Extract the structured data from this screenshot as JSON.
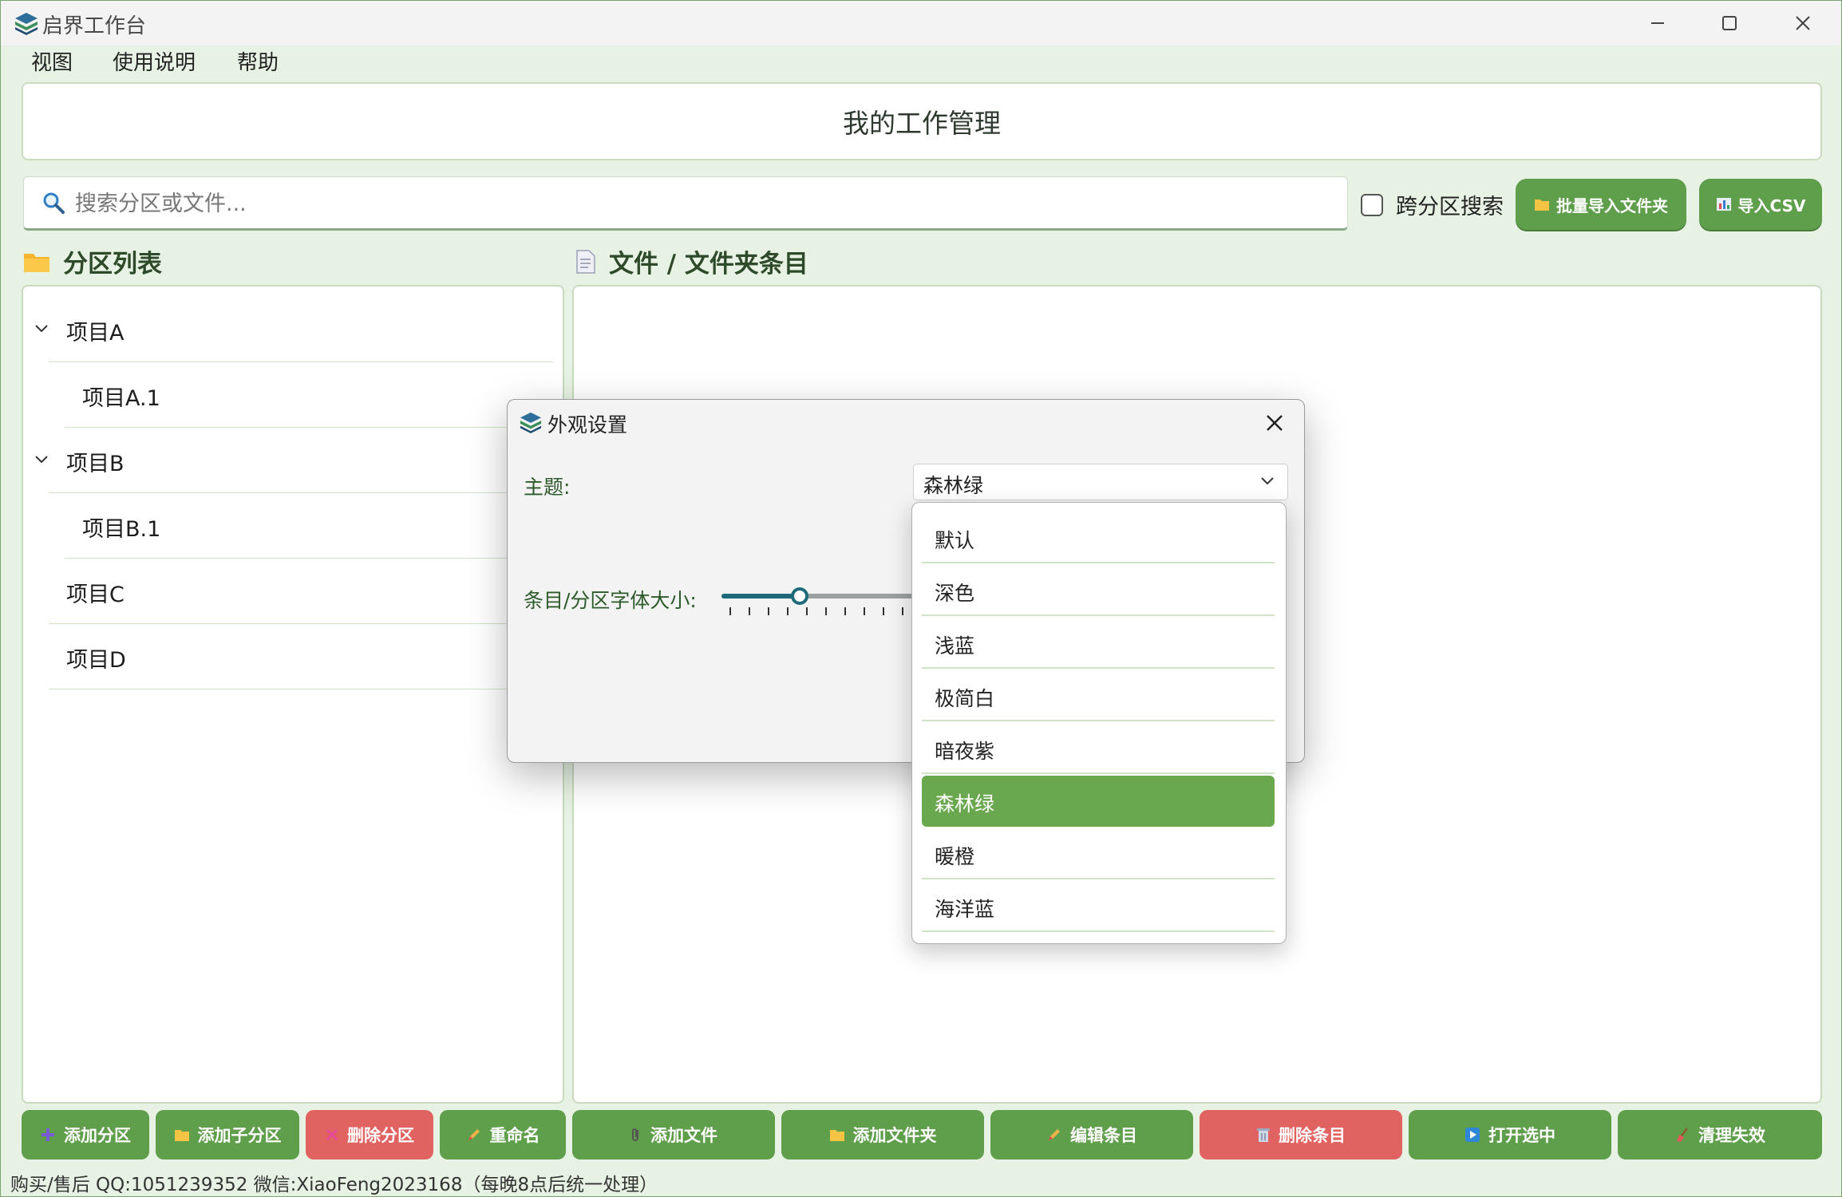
{
  "window": {
    "title": "启界工作台"
  },
  "menu": [
    "视图",
    "使用说明",
    "帮助"
  ],
  "header": {
    "title": "我的工作管理"
  },
  "search": {
    "placeholder": "搜索分区或文件...",
    "value": ""
  },
  "cross_search": {
    "label": "跨分区搜索",
    "checked": false
  },
  "top_buttons": {
    "batch_import": "批量导入文件夹",
    "import_csv": "导入CSV"
  },
  "sections": {
    "partitions": "分区列表",
    "files": "文件 / 文件夹条目"
  },
  "tree": [
    {
      "label": "项目A",
      "level": 0,
      "expanded": true
    },
    {
      "label": "项目A.1",
      "level": 1
    },
    {
      "label": "项目B",
      "level": 0,
      "expanded": true
    },
    {
      "label": "项目B.1",
      "level": 1
    },
    {
      "label": "项目C",
      "level": 0
    },
    {
      "label": "项目D",
      "level": 0
    }
  ],
  "bottom_buttons": {
    "add_partition": "添加分区",
    "add_subpartition": "添加子分区",
    "delete_partition": "删除分区",
    "rename": "重命名",
    "add_file": "添加文件",
    "add_folder": "添加文件夹",
    "edit_entry": "编辑条目",
    "delete_entry": "删除条目",
    "open_selected": "打开选中",
    "clean_invalid": "清理失效"
  },
  "status": "购买/售后 QQ:1051239352 微信:XiaoFeng2023168（每晚8点后统一处理）",
  "dialog": {
    "title": "外观设置",
    "theme_label": "主题:",
    "theme_value": "森林绿",
    "font_label": "条目/分区字体大小:",
    "font_size_fraction": 0.4,
    "theme_options": [
      "默认",
      "深色",
      "浅蓝",
      "极简白",
      "暗夜紫",
      "森林绿",
      "暖橙",
      "海洋蓝"
    ],
    "selected_index": 5
  },
  "colors": {
    "accent": "#5f9e4b",
    "danger": "#e06361",
    "selected": "#6aa84f",
    "slider": "#1d6b78"
  }
}
